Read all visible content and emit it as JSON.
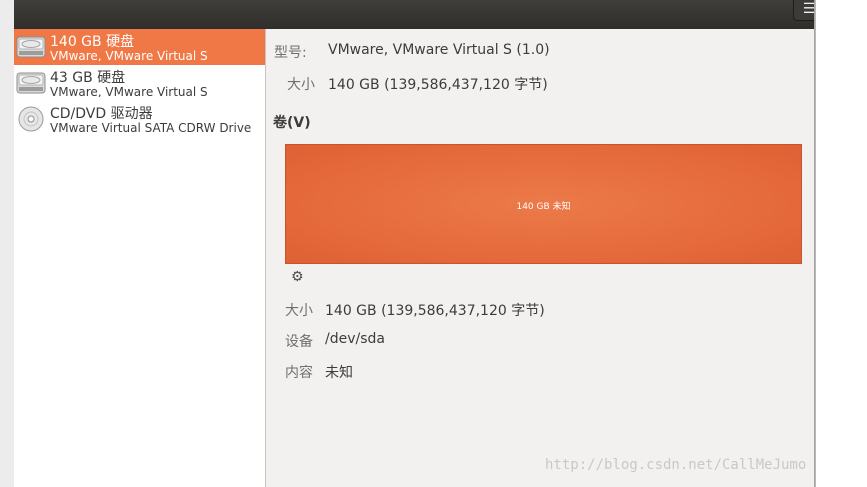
{
  "titlebar": {
    "menu_icon": "hamburger-menu-icon",
    "menu_glyph": "☰"
  },
  "disks": [
    {
      "title": "140 GB 硬盘",
      "subtitle": "VMware, VMware Virtual S",
      "icon": "hard-disk-icon",
      "selected": true
    },
    {
      "title": "43 GB 硬盘",
      "subtitle": "VMware, VMware Virtual S",
      "icon": "hard-disk-icon",
      "selected": false
    },
    {
      "title": "CD/DVD 驱动器",
      "subtitle": "VMware Virtual SATA CDRW Drive",
      "icon": "optical-disc-icon",
      "selected": false
    }
  ],
  "drive": {
    "model_label": "型号:",
    "model_value": "VMware, VMware Virtual S (1.0)",
    "size_label": "大小",
    "size_value": "140 GB (139,586,437,120 字节)"
  },
  "volumes": {
    "title": "卷(V)",
    "bar_label": "140 GB 未知",
    "gear_icon": "gear-icon",
    "gear_glyph": "⚙"
  },
  "partition": {
    "size_label": "大小",
    "size_value": "140 GB (139,586,437,120 字节)",
    "device_label": "设备",
    "device_value": "/dev/sda",
    "contents_label": "内容",
    "contents_value": "未知"
  },
  "watermark": "http://blog.csdn.net/CallMeJumo",
  "colors": {
    "selection": "#f07746",
    "volume_fill": "#e4683a",
    "titlebar": "#3c3b37",
    "content_bg": "#f2f1f0"
  }
}
